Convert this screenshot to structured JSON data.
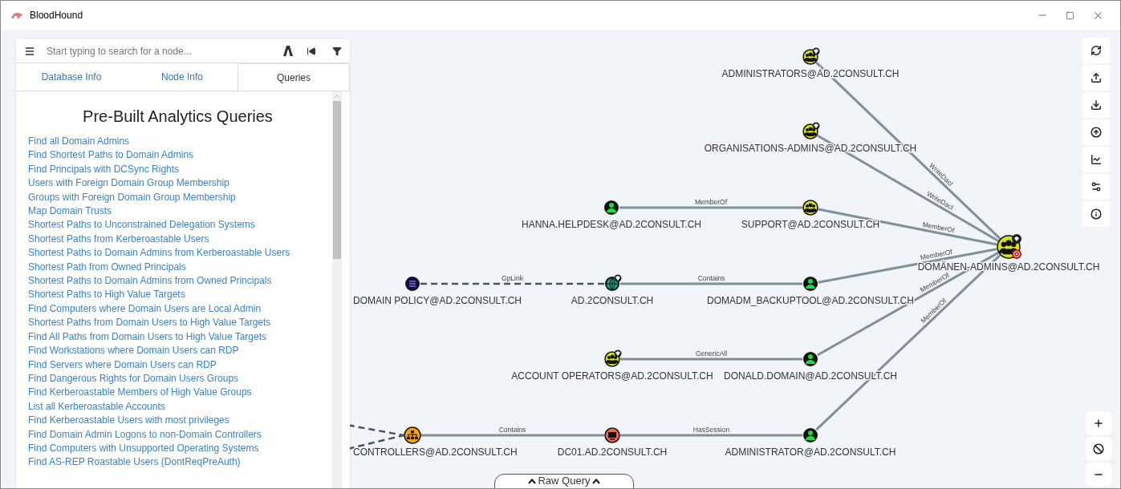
{
  "window": {
    "title": "BloodHound"
  },
  "search": {
    "placeholder": "Start typing to search for a node..."
  },
  "tabs": [
    {
      "label": "Database Info",
      "selected": false
    },
    {
      "label": "Node Info",
      "selected": false
    },
    {
      "label": "Queries",
      "selected": true
    }
  ],
  "queries_panel": {
    "heading": "Pre-Built Analytics Queries",
    "items": [
      "Find all Domain Admins",
      "Find Shortest Paths to Domain Admins",
      "Find Principals with DCSync Rights",
      "Users with Foreign Domain Group Membership",
      "Groups with Foreign Domain Group Membership",
      "Map Domain Trusts",
      "Shortest Paths to Unconstrained Delegation Systems",
      "Shortest Paths from Kerberoastable Users",
      "Shortest Paths to Domain Admins from Kerberoastable Users",
      "Shortest Path from Owned Principals",
      "Shortest Paths to Domain Admins from Owned Principals",
      "Shortest Paths to High Value Targets",
      "Find Computers where Domain Users are Local Admin",
      "Shortest Paths from Domain Users to High Value Targets",
      "Find All Paths from Domain Users to High Value Targets",
      "Find Workstations where Domain Users can RDP",
      "Find Servers where Domain Users can RDP",
      "Find Dangerous Rights for Domain Users Groups",
      "Find Kerberoastable Members of High Value Groups",
      "List all Kerberoastable Accounts",
      "Find Kerberoastable Users with most privileges",
      "Find Domain Admin Logons to non-Domain Controllers",
      "Find Computers with Unsupported Operating Systems",
      "Find AS-REP Roastable Users (DontReqPreAuth)"
    ]
  },
  "graph": {
    "nodes": [
      {
        "kind": "group",
        "label": "ADMINISTRATORS@AD.2CONSULT.CH",
        "high_value": true,
        "target": false
      },
      {
        "kind": "group",
        "label": "ORGANISATIONS-ADMINS@AD.2CONSULT.CH",
        "high_value": true,
        "target": false
      },
      {
        "kind": "user",
        "label": "HANNA.HELPDESK@AD.2CONSULT.CH",
        "high_value": false,
        "target": false
      },
      {
        "kind": "group",
        "label": "SUPPORT@AD.2CONSULT.CH",
        "high_value": false,
        "target": false
      },
      {
        "kind": "group",
        "label": "DOMÄNEN-ADMINS@AD.2CONSULT.CH",
        "high_value": true,
        "target": true
      },
      {
        "kind": "gpo",
        "label": "DOMAIN POLICY@AD.2CONSULT.CH",
        "high_value": false,
        "target": false
      },
      {
        "kind": "domain",
        "label": "AD.2CONSULT.CH",
        "high_value": true,
        "target": false
      },
      {
        "kind": "user",
        "label": "DOMADM_BACKUPTOOL@AD.2CONSULT.CH",
        "high_value": false,
        "target": false
      },
      {
        "kind": "group",
        "label": "ACCOUNT OPERATORS@AD.2CONSULT.CH",
        "high_value": true,
        "target": false
      },
      {
        "kind": "user",
        "label": "DONALD.DOMAIN@AD.2CONSULT.CH",
        "high_value": false,
        "target": false
      },
      {
        "kind": "ou",
        "label": "CONTROLLERS@AD.2CONSULT.CH",
        "high_value": false,
        "target": false
      },
      {
        "kind": "computer",
        "label": "DC01.AD.2CONSULT.CH",
        "high_value": false,
        "target": false
      },
      {
        "kind": "user",
        "label": "ADMINISTRATOR@AD.2CONSULT.CH",
        "high_value": false,
        "target": false
      }
    ],
    "edges": [
      {
        "label": "WriteDacl",
        "dashed": false
      },
      {
        "label": "WriteDacl",
        "dashed": false
      },
      {
        "label": "MemberOf",
        "dashed": false
      },
      {
        "label": "MemberOf",
        "dashed": false
      },
      {
        "label": "GpLink",
        "dashed": true
      },
      {
        "label": "Contains",
        "dashed": false
      },
      {
        "label": "MemberOf",
        "dashed": false
      },
      {
        "label": "GenericAll",
        "dashed": false
      },
      {
        "label": "MemberOf",
        "dashed": false
      },
      {
        "label": "Contains",
        "dashed": false
      },
      {
        "label": "HasSession",
        "dashed": false
      },
      {
        "label": "MemberOf",
        "dashed": false
      }
    ],
    "offscreen_edges": [
      {
        "dashed": true
      },
      {
        "dashed": true
      }
    ]
  },
  "raw_query": {
    "label": "Raw Query"
  }
}
